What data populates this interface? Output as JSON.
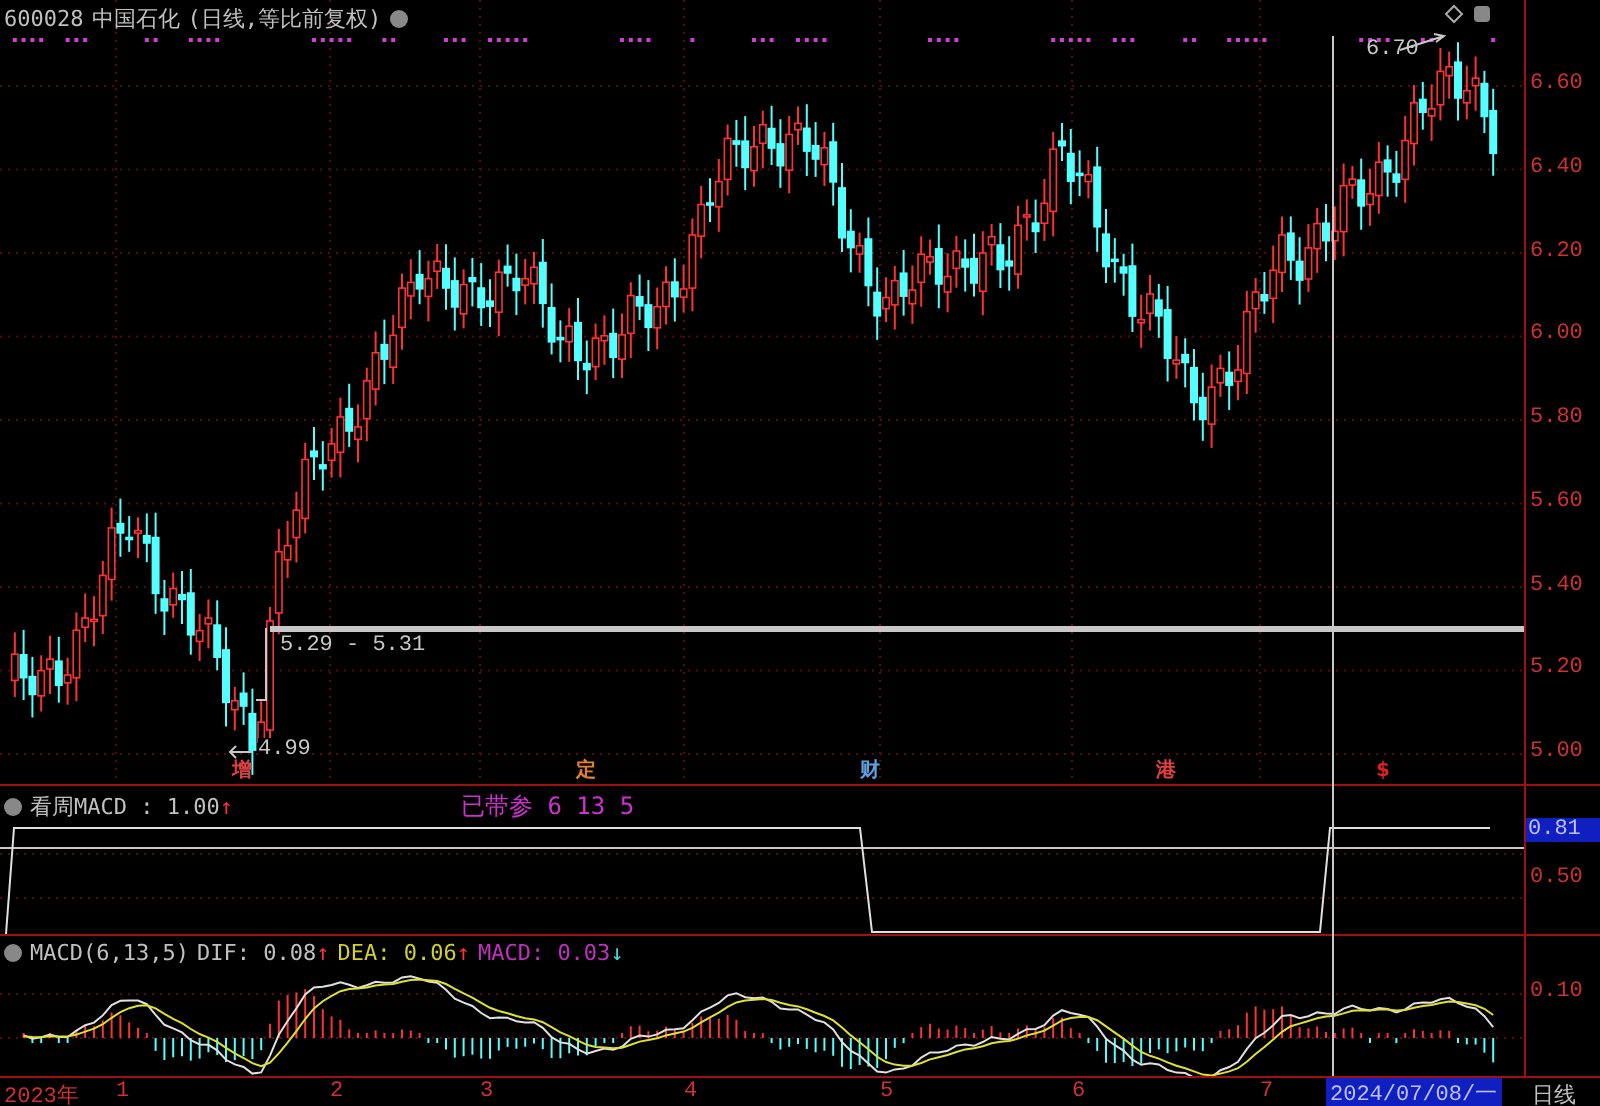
{
  "header": {
    "code": "600028",
    "name": "中国石化",
    "mode": "(日线,等比前复权)"
  },
  "price_axis": [
    "6.60",
    "6.40",
    "6.20",
    "6.00",
    "5.80",
    "5.60",
    "5.40",
    "5.20",
    "5.00"
  ],
  "annotations": {
    "high": "6.70",
    "range": "5.29 - 5.31",
    "low": "4.99"
  },
  "events": [
    {
      "label": "增",
      "color": "#e04040"
    },
    {
      "label": "定",
      "color": "#e08030"
    },
    {
      "label": "财",
      "color": "#60a0e0"
    },
    {
      "label": "港",
      "color": "#e04040"
    },
    {
      "label": "$",
      "color": "#e02020"
    }
  ],
  "weekly_macd": {
    "title": "看周MACD : 1.00",
    "arrow": "↑",
    "params": "已带参  6  13  5",
    "axis": [
      {
        "label": "0.81",
        "selected": true
      },
      {
        "label": "0.50",
        "selected": false
      }
    ]
  },
  "macd": {
    "items": [
      {
        "label": "MACD(6,13,5)",
        "color": "#c0c0c0"
      },
      {
        "label": "DIF: 0.08",
        "arrow": "↑",
        "color": "#c0c0c0"
      },
      {
        "label": "DEA: 0.06",
        "arrow": "↑",
        "color": "#d0d030"
      },
      {
        "label": "MACD: 0.03",
        "arrow": "↓",
        "color": "#c030c0"
      }
    ],
    "axis": [
      "0.10"
    ]
  },
  "time_axis": {
    "labels": [
      "2023年",
      "1",
      "2",
      "3",
      "4",
      "5",
      "6",
      "7"
    ],
    "crosshair_date": "2024/07/08/一",
    "period": "日线"
  }
}
